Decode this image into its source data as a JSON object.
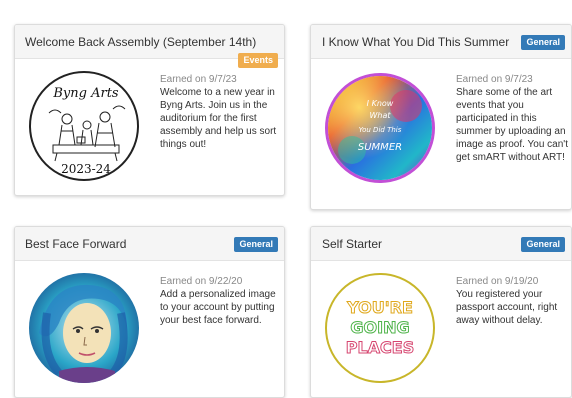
{
  "cards": [
    {
      "title": "Welcome Back Assembly (September 14th)",
      "badge": "Events",
      "earned": "Earned on 9/7/23",
      "description": "Welcome to a new year in Byng Arts. Join us in the auditorium for the first assembly and help us sort things out!",
      "medal": {
        "line1": "Byng Arts",
        "line2": "2023-24"
      }
    },
    {
      "title": "I Know What You Did This Summer",
      "badge": "General",
      "earned": "Earned on 9/7/23",
      "description": "Share some of the art events that you participated in this summer by uploading an image as proof. You can't get smART without ART!",
      "medal": {
        "line1": "I Know",
        "line2": "What",
        "line3": "You Did This",
        "line4": "SUMMER"
      }
    },
    {
      "title": "Best Face Forward",
      "badge": "General",
      "earned": "Earned on 9/22/20",
      "description": "Add a personalized image to your account by putting your best face forward."
    },
    {
      "title": "Self Starter",
      "badge": "General",
      "earned": "Earned on 9/19/20",
      "description": "You registered your passport account, right away without delay.",
      "medal": {
        "line1": "YOU'RE",
        "line2": "GOING",
        "line3": "PLACES"
      }
    }
  ],
  "colors": {
    "general_badge": "#337ab7",
    "events_badge": "#f0ad4e"
  }
}
